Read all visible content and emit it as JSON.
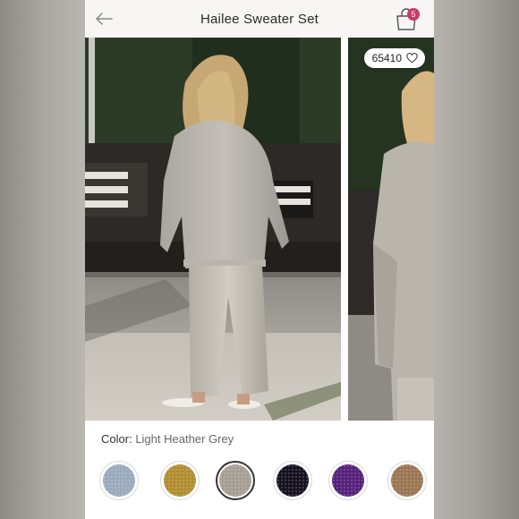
{
  "header": {
    "title": "Hailee Sweater Set",
    "cart_count": "5"
  },
  "gallery": {
    "like_count": "65410"
  },
  "color": {
    "label": "Color:",
    "value": "Light Heather Grey"
  },
  "swatches": [
    {
      "name": "swatch-light-blue",
      "color": "#9aa9bd"
    },
    {
      "name": "swatch-mustard",
      "color": "#b08d2e"
    },
    {
      "name": "swatch-light-heather-grey",
      "color": "#a59e92",
      "selected": true
    },
    {
      "name": "swatch-black",
      "color": "#15101f"
    },
    {
      "name": "swatch-purple",
      "color": "#54207a"
    },
    {
      "name": "swatch-brown",
      "color": "#9a7552"
    }
  ],
  "icons": {
    "back": "arrow-left-icon",
    "cart": "shopping-bag-icon",
    "like": "heart-icon"
  }
}
